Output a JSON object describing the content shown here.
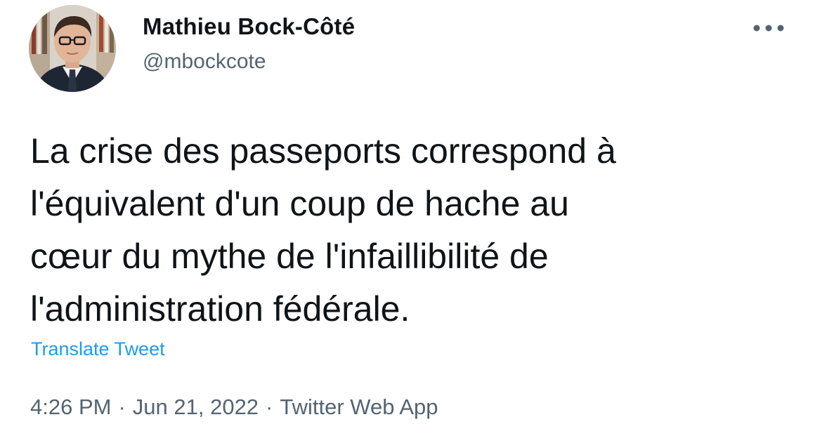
{
  "author": {
    "display_name": "Mathieu Bock-Côté",
    "handle": "@mbockcote",
    "avatar_icon": "profile-photo"
  },
  "more_icon": "more-horizontal-icon",
  "tweet": {
    "lines": [
      "La crise des passeports correspond à",
      "l'équivalent d'un coup de hache au",
      "cœur du mythe de l'infaillibilité de",
      "l'administration fédérale."
    ],
    "translate_label": "Translate Tweet"
  },
  "meta": {
    "time": "4:26 PM",
    "separator": "·",
    "date": "Jun 21, 2022",
    "source": "Twitter Web App"
  },
  "colors": {
    "text": "#0f1419",
    "secondary": "#536471",
    "link": "#1d9bf0",
    "background": "#ffffff"
  }
}
